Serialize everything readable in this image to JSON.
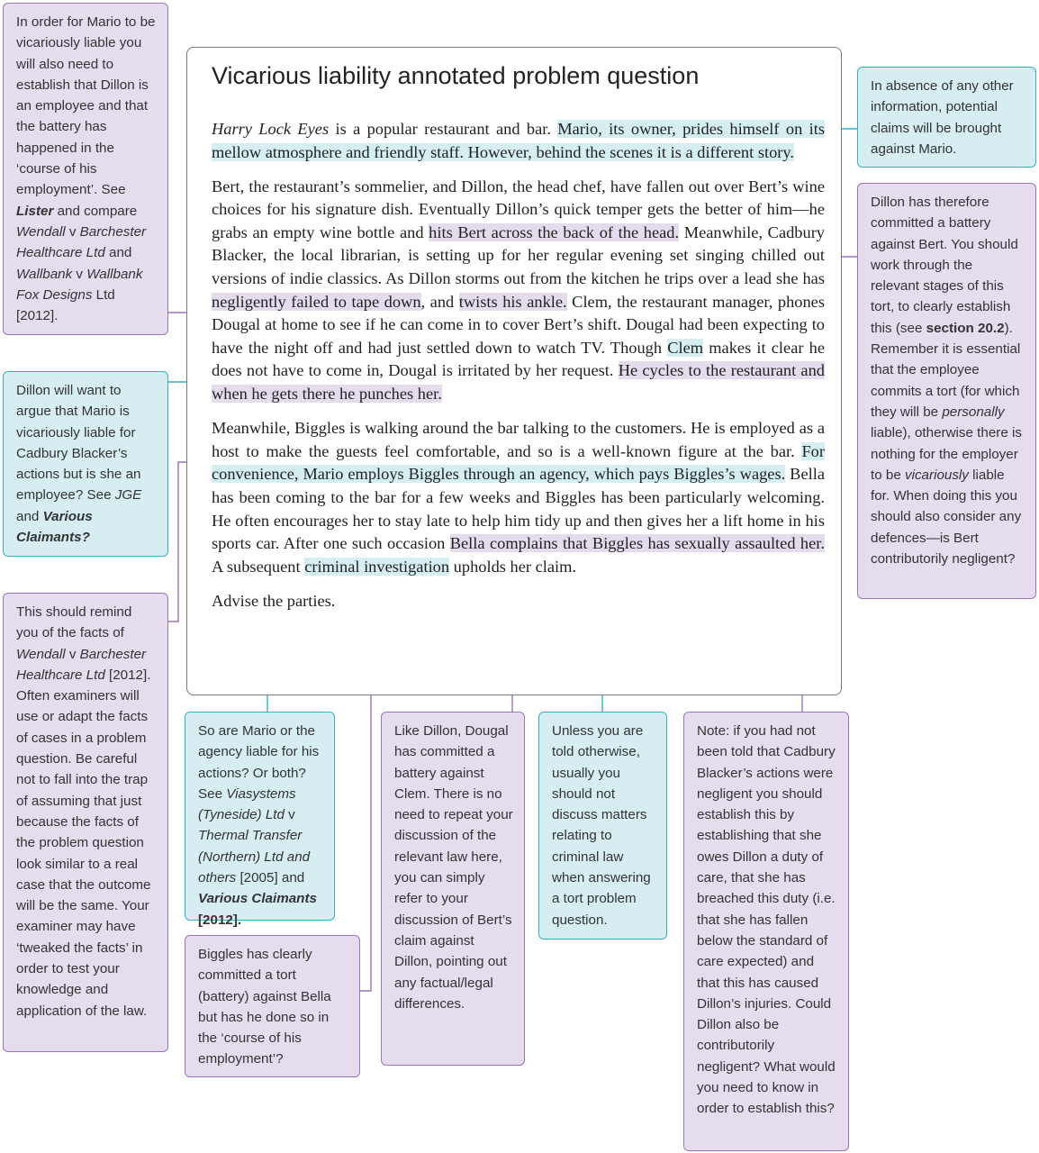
{
  "colors": {
    "cyan_fill": "#d6eef2",
    "cyan_border": "#33b2c0",
    "purple_fill": "#e5dcee",
    "purple_border": "#9c73b9"
  },
  "title": "Vicarious liability annotated problem question",
  "paragraphs": [
    [
      {
        "t": "Harry Lock Eyes",
        "i": true
      },
      {
        "t": " is a popular restaurant and bar. "
      },
      {
        "t": "Mario, its owner, prides himself on its mellow atmosphere and friendly staff. However, behind the scenes it is a different story.",
        "hl": "cyan"
      }
    ],
    [
      {
        "t": "Bert, the restaurant’s sommelier, and Dillon, the head chef, have fallen out over Bert’s wine choices for his signature dish. Eventually Dillon’s quick temper gets the better of him—he grabs an empty wine bottle and "
      },
      {
        "t": "hits Bert across the back of the head.",
        "hl": "purple"
      },
      {
        "t": " Meanwhile, Cadbury Blacker, the local librarian, is setting up for her regular evening set singing chilled out versions of indie classics. As Dillon storms out from the kitchen he trips over a lead she has "
      },
      {
        "t": "negligently failed to tape down",
        "hl": "purple"
      },
      {
        "t": ", and "
      },
      {
        "t": "twists his ankle.",
        "hl": "purple"
      },
      {
        "t": " Clem, the restaurant manager, phones Dougal at home to see if he can come in to cover Bert’s shift. Dougal had been expecting to have the night off and had just settled down to watch TV. Though "
      },
      {
        "t": "Clem",
        "hl": "cyan"
      },
      {
        "t": " makes it clear he does not have to come in, Dougal is irritated by her request. "
      },
      {
        "t": "He cycles to the restaurant and when he gets there he punches her.",
        "hl": "purple"
      }
    ],
    [
      {
        "t": "Meanwhile, Biggles is walking around the bar talking to the customers. He is employed as a host to make the guests feel comfortable, and so is a well-known figure at the bar. "
      },
      {
        "t": "For convenience, Mario employs Biggles through an agency, which pays Biggles’s wages.",
        "hl": "cyan"
      },
      {
        "t": " Bella has been coming to the bar for a few weeks and Biggles has been particularly welcoming. He often encourages her to stay late to help him tidy up and then gives her a lift home in his sports car. After one such occasion "
      },
      {
        "t": "Bella complains that Biggles has sexually assaulted her.",
        "hl": "purple"
      },
      {
        "t": " A subsequent "
      },
      {
        "t": "criminal investigation",
        "hl": "cyan"
      },
      {
        "t": " upholds her claim."
      }
    ],
    [
      {
        "t": "Advise the parties."
      }
    ]
  ],
  "notes": [
    {
      "id": "n1",
      "color": "purple",
      "segs": [
        {
          "t": "In order for Mario to be vicariously liable you will also need to establish that Dillon is an employee and that the battery has happened in the ‘course of his employment’. See "
        },
        {
          "t": "Lister",
          "b": true,
          "i": true
        },
        {
          "t": " and compare "
        },
        {
          "t": "Wendall",
          "i": true
        },
        {
          "t": " v "
        },
        {
          "t": "Barchester Healthcare Ltd",
          "i": true
        },
        {
          "t": " and "
        },
        {
          "t": "Wallbank",
          "i": true
        },
        {
          "t": " v "
        },
        {
          "t": "Wallbank Fox Designs",
          "i": true
        },
        {
          "t": " Ltd [2012]."
        }
      ]
    },
    {
      "id": "n2",
      "color": "cyan",
      "segs": [
        {
          "t": "Dillon will want to argue that Mario is vicariously liable for Cadbury Blacker’s actions but is she an employee? See "
        },
        {
          "t": "JGE",
          "i": true
        },
        {
          "t": " and "
        },
        {
          "t": "Various Claimants?",
          "b": true,
          "i": true
        }
      ]
    },
    {
      "id": "n3",
      "color": "purple",
      "segs": [
        {
          "t": "This should remind you of the facts of "
        },
        {
          "t": "Wendall",
          "i": true
        },
        {
          "t": " v "
        },
        {
          "t": "Barchester Healthcare Ltd",
          "i": true
        },
        {
          "t": " [2012]. Often examiners will use or adapt the facts of cases in a problem question. Be careful not to fall into the trap of assuming that just because the facts of the problem question look similar to a real case that the outcome will be the same. Your examiner may have ‘tweaked the facts’ in order to test your knowledge and application of the law."
        }
      ]
    },
    {
      "id": "n4",
      "color": "cyan",
      "segs": [
        {
          "t": "So are Mario or the agency liable for his actions? Or both? See "
        },
        {
          "t": "Viasystems (Tyneside) Ltd",
          "i": true
        },
        {
          "t": " v "
        },
        {
          "t": "Thermal Transfer (Northern) Ltd and others",
          "i": true
        },
        {
          "t": " [2005] and "
        },
        {
          "t": "Various Claimants",
          "b": true,
          "i": true
        },
        {
          "t": " [2012].",
          "b": true
        }
      ]
    },
    {
      "id": "n5",
      "color": "purple",
      "segs": [
        {
          "t": "Biggles has clearly committed a tort (battery) against Bella but has he done so in the ‘course of his employment’?"
        }
      ]
    },
    {
      "id": "n6",
      "color": "purple",
      "segs": [
        {
          "t": "Like Dillon, Dougal has committed a battery against Clem. There is no need to repeat your discussion of the relevant law here, you can simply refer to your discussion of Bert’s claim against Dillon, pointing out any factual/legal differences."
        }
      ]
    },
    {
      "id": "n7",
      "color": "cyan",
      "segs": [
        {
          "t": "Unless you are told otherwise, usually you should not discuss matters relating to criminal law when answering a tort problem question."
        }
      ]
    },
    {
      "id": "n8",
      "color": "purple",
      "segs": [
        {
          "t": "Note: if you had not been told that Cadbury Blacker’s actions were negligent you should establish this by establishing that she owes Dillon a duty of care, that she has breached this duty (i.e. that she has fallen below the standard of care expected) and that this has caused Dillon’s injuries. Could Dillon also be contributorily negligent? What would you need to know in order to establish this?"
        }
      ]
    },
    {
      "id": "n9",
      "color": "cyan",
      "segs": [
        {
          "t": "In absence of any other information, potential claims will be brought against Mario."
        }
      ]
    },
    {
      "id": "n10",
      "color": "purple",
      "segs": [
        {
          "t": "Dillon has therefore committed a battery against Bert. You should work through the relevant stages of this tort, to clearly establish this (see "
        },
        {
          "t": "section 20.2",
          "b": true
        },
        {
          "t": "). Remember it is essential that the employee commits a tort (for which they will be "
        },
        {
          "t": "personally",
          "i": true
        },
        {
          "t": " liable), otherwise there is nothing for the employer to be "
        },
        {
          "t": "vicariously",
          "i": true
        },
        {
          "t": " liable for. When doing this you should also consider any defences—is Bert contributorily negligent?"
        }
      ]
    }
  ]
}
